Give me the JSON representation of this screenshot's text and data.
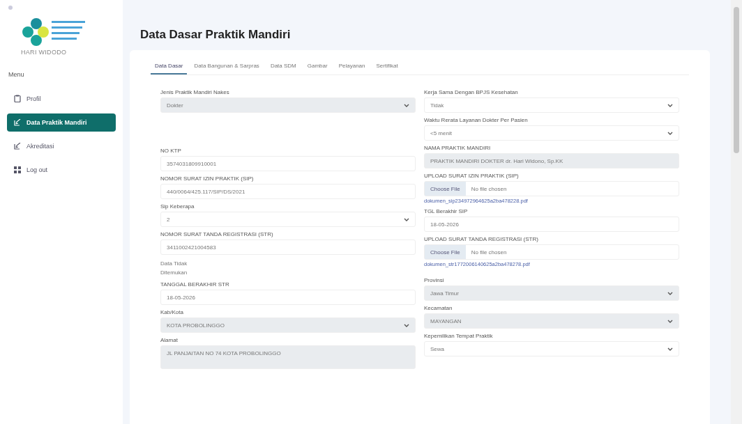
{
  "sidebar": {
    "user_name": "HARI WIDODO",
    "menu_heading": "Menu",
    "items": [
      {
        "label": "Profil",
        "kind": "clipboard",
        "selected": false
      },
      {
        "label": "Data Praktik Mandiri",
        "kind": "edit",
        "selected": true
      },
      {
        "label": "Akreditasi",
        "kind": "edit",
        "selected": false
      },
      {
        "label": "Log out",
        "kind": "grid",
        "selected": false
      }
    ]
  },
  "page_title": "Data Dasar Praktik Mandiri",
  "tabs": [
    {
      "label": "Data Dasar",
      "selected": true
    },
    {
      "label": "Data Bangunan & Sarpras",
      "selected": false
    },
    {
      "label": "Data SDM",
      "selected": false
    },
    {
      "label": "Gambar",
      "selected": false
    },
    {
      "label": "Pelayanan",
      "selected": false
    },
    {
      "label": "Sertifikat",
      "selected": false
    }
  ],
  "left_fields": [
    {
      "kind": "select",
      "label": "Jenis Praktik Mandiri Nakes",
      "value": "Dokter",
      "disabled": true
    },
    {
      "kind": "input",
      "label": "NO KTP",
      "value": "3574031809910001",
      "disabled": false
    },
    {
      "kind": "input",
      "label": "NOMOR SURAT IZIN PRAKTIK (SIP)",
      "value": "440/0064/425.117/SIP/DS/2021",
      "disabled": false
    },
    {
      "kind": "select",
      "label": "Sip Keberapa",
      "value": "2",
      "disabled": false
    },
    {
      "kind": "input",
      "label": "NOMOR SURAT TANDA REGISTRASI (STR)",
      "value": "3411002421004583",
      "disabled": false
    },
    {
      "kind": "note",
      "lines": [
        "Data Tidak",
        "Ditemukan"
      ]
    },
    {
      "kind": "input",
      "label": "TANGGAL BERAKHIR STR",
      "value": "18-05-2026",
      "disabled": false
    },
    {
      "kind": "select",
      "label": "Kab/Kota",
      "value": "KOTA PROBOLINGGO",
      "disabled": true
    },
    {
      "kind": "textarea",
      "label": "Alamat",
      "value": "JL PANJAITAN NO 74 KOTA PROBOLINGGO",
      "disabled": true
    }
  ],
  "right_fields": [
    {
      "kind": "select",
      "label": "Kerja Sama Dengan BPJS Kesehatan",
      "value": "Tidak",
      "disabled": false
    },
    {
      "kind": "select",
      "label": "Waktu Rerata Layanan Dokter Per Pasien",
      "value": "<5 menit",
      "disabled": false
    },
    {
      "kind": "input",
      "label": "NAMA PRAKTIK MANDIRI",
      "value": "PRAKTIK MANDIRI DOKTER dr. Hari Widono, Sp.KK",
      "disabled": true
    },
    {
      "kind": "file",
      "label": "UPLOAD SURAT IZIN PRAKTIK (SIP)",
      "button": "Choose File",
      "status": "No file chosen",
      "link": "dokumen_sip234972964625a2ba478228.pdf"
    },
    {
      "kind": "input",
      "label": "TGL Berakhir SIP",
      "value": "18-05-2026",
      "disabled": false
    },
    {
      "kind": "file",
      "label": "UPLOAD SURAT TANDA REGISTRASI (STR)",
      "button": "Choose File",
      "status": "No file chosen",
      "link": "dokumen_str1772006140625a2ba478278.pdf"
    },
    {
      "kind": "select",
      "label": "Provinsi",
      "value": "Jawa Timur",
      "disabled": true
    },
    {
      "kind": "select",
      "label": "Kecamatan",
      "value": "MAYANGAN",
      "disabled": true
    },
    {
      "kind": "select",
      "label": "Kepemilikan Tempat Praktik",
      "value": "Sewa",
      "disabled": false
    }
  ]
}
